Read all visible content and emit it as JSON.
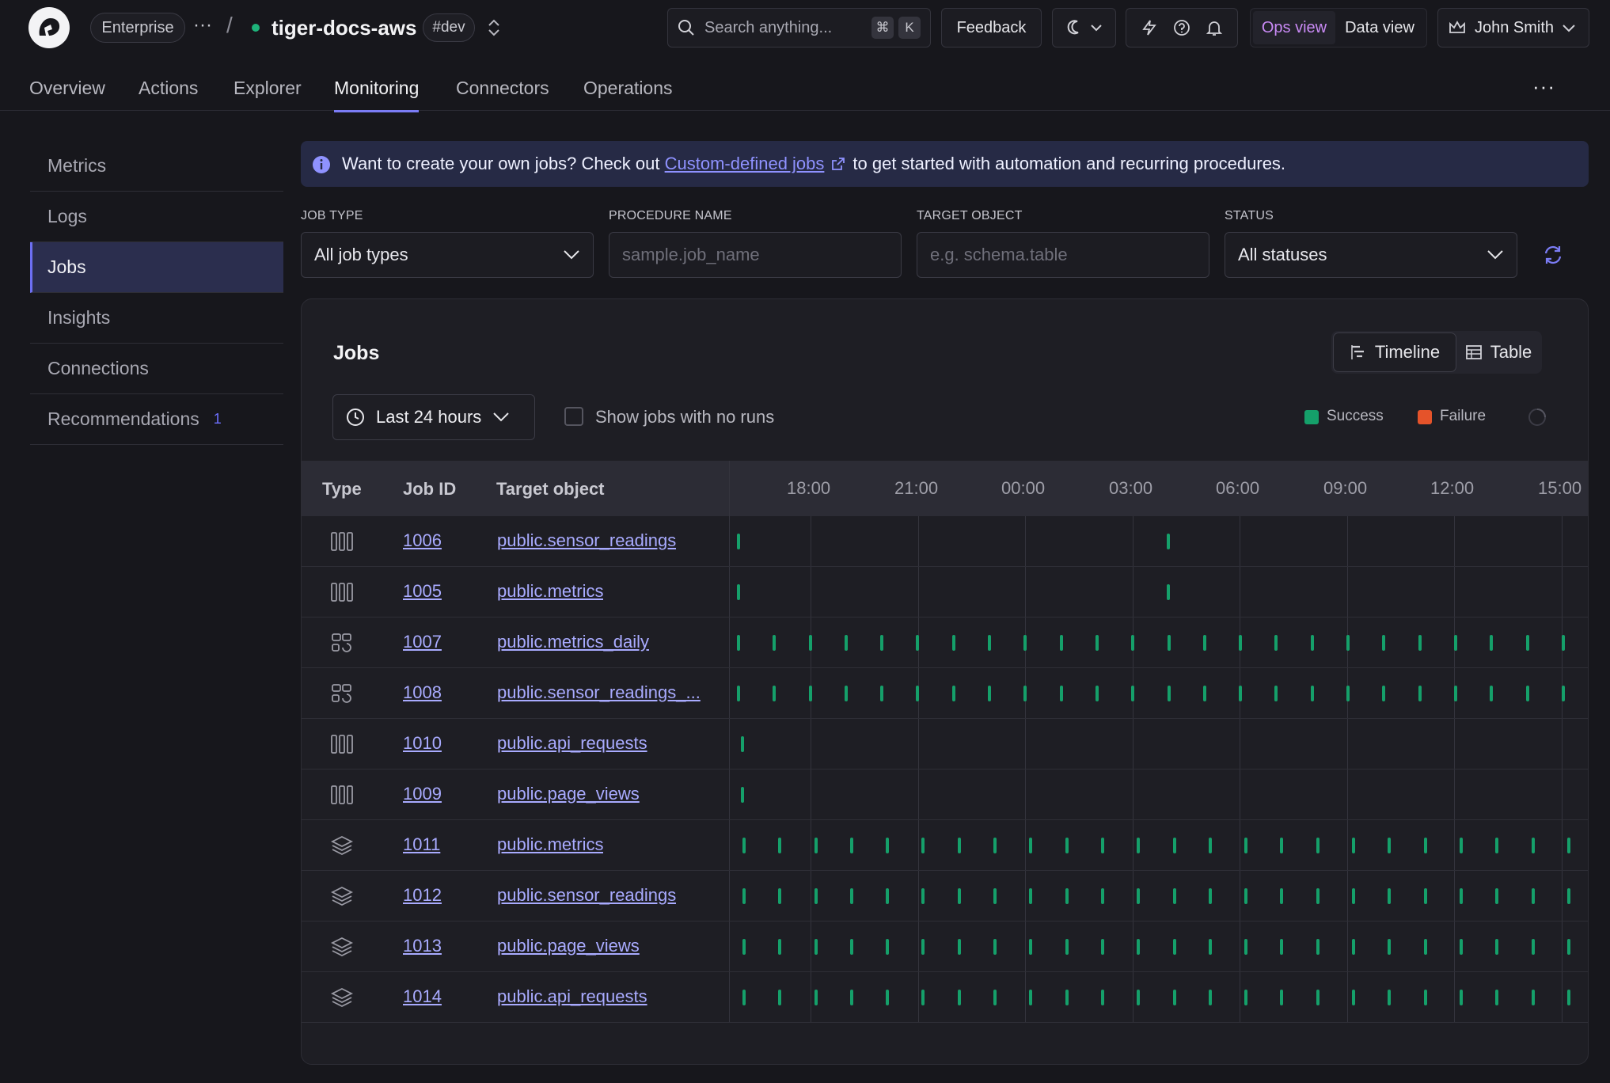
{
  "header": {
    "org_label": "Enterprise",
    "service_name": "tiger-docs-aws",
    "env_tag": "#dev",
    "search_placeholder": "Search anything...",
    "shortcut_mod": "⌘",
    "shortcut_key": "K",
    "feedback_label": "Feedback",
    "ops_view_label": "Ops view",
    "data_view_label": "Data view",
    "user_name": "John Smith"
  },
  "tabs": [
    "Overview",
    "Actions",
    "Explorer",
    "Monitoring",
    "Connectors",
    "Operations"
  ],
  "active_tab": "Monitoring",
  "sidebar": {
    "items": [
      {
        "label": "Metrics",
        "badge": ""
      },
      {
        "label": "Logs",
        "badge": ""
      },
      {
        "label": "Jobs",
        "badge": ""
      },
      {
        "label": "Insights",
        "badge": ""
      },
      {
        "label": "Connections",
        "badge": ""
      },
      {
        "label": "Recommendations",
        "badge": "1"
      }
    ],
    "active": "Jobs"
  },
  "banner": {
    "prefix": "Want to create your own jobs? Check out",
    "link": "Custom-defined jobs",
    "suffix": "to get started with automation and recurring procedures."
  },
  "filters": {
    "job_type_label": "JOB TYPE",
    "job_type_value": "All job types",
    "procedure_label": "PROCEDURE NAME",
    "procedure_placeholder": "sample.job_name",
    "target_label": "TARGET OBJECT",
    "target_placeholder": "e.g. schema.table",
    "status_label": "STATUS",
    "status_value": "All statuses"
  },
  "jobs_panel": {
    "title": "Jobs",
    "timeline_label": "Timeline",
    "table_label": "Table",
    "range_label": "Last 24 hours",
    "no_runs_label": "Show jobs with no runs",
    "legend_success": "Success",
    "legend_failure": "Failure",
    "colors": {
      "success": "#15a06a",
      "failure": "#e5532a",
      "accent": "#7b7cf5"
    },
    "columns": [
      "Type",
      "Job ID",
      "Target object"
    ],
    "hours": [
      "18:00",
      "21:00",
      "00:00",
      "03:00",
      "06:00",
      "09:00",
      "12:00",
      "15:00"
    ],
    "rows": [
      {
        "type_icon": "columnar-icon",
        "id": "1006",
        "target": "public.sensor_readings",
        "schedule": "sparse"
      },
      {
        "type_icon": "columnar-icon",
        "id": "1005",
        "target": "public.metrics",
        "schedule": "sparse"
      },
      {
        "type_icon": "refresh-cagg-icon",
        "id": "1007",
        "target": "public.metrics_daily",
        "schedule": "hourly"
      },
      {
        "type_icon": "refresh-cagg-icon",
        "id": "1008",
        "target": "public.sensor_readings_...",
        "schedule": "hourly"
      },
      {
        "type_icon": "columnar-icon",
        "id": "1010",
        "target": "public.api_requests",
        "schedule": "single"
      },
      {
        "type_icon": "columnar-icon",
        "id": "1009",
        "target": "public.page_views",
        "schedule": "single"
      },
      {
        "type_icon": "layers-icon",
        "id": "1011",
        "target": "public.metrics",
        "schedule": "hourly-offset"
      },
      {
        "type_icon": "layers-icon",
        "id": "1012",
        "target": "public.sensor_readings",
        "schedule": "hourly-offset"
      },
      {
        "type_icon": "layers-icon",
        "id": "1013",
        "target": "public.page_views",
        "schedule": "hourly-offset"
      },
      {
        "type_icon": "layers-icon",
        "id": "1014",
        "target": "public.api_requests",
        "schedule": "hourly-offset"
      }
    ]
  }
}
